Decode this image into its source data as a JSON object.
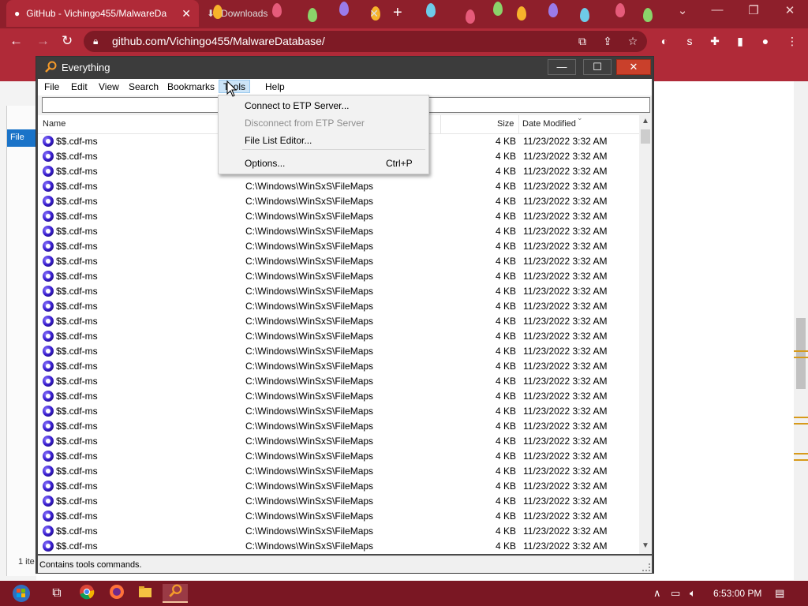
{
  "browser": {
    "tabs": [
      {
        "title": "GitHub - Vichingo455/MalwareDa",
        "active": true
      },
      {
        "title": "Downloads",
        "active": false
      }
    ],
    "new_tab_symbol": "+",
    "url": "github.com/Vichingo455/MalwareDatabase/",
    "icons": [
      "back-icon",
      "forward-icon",
      "reload-icon",
      "lock-icon",
      "install-icon",
      "share-icon",
      "star-icon",
      "extensions-icon",
      "sidebar-icon",
      "profile-icon",
      "menu-icon"
    ],
    "accent": "#b02a38"
  },
  "explorer": {
    "ribbon_label": "File",
    "item_count": "1 ite"
  },
  "everything": {
    "title": "Everything",
    "menus": [
      "File",
      "Edit",
      "View",
      "Search",
      "Bookmarks",
      "Tools",
      "Help"
    ],
    "open_menu": "Tools",
    "search_value": "",
    "columns": {
      "name": "Name",
      "size": "Size",
      "date": "Date Modified"
    },
    "rows": [
      {
        "name": "$$.cdf-ms",
        "path": "",
        "size": "4 KB",
        "date": "11/23/2022 3:32 AM"
      },
      {
        "name": "$$.cdf-ms",
        "path": "",
        "size": "4 KB",
        "date": "11/23/2022 3:32 AM"
      },
      {
        "name": "$$.cdf-ms",
        "path": "",
        "size": "4 KB",
        "date": "11/23/2022 3:32 AM"
      },
      {
        "name": "$$.cdf-ms",
        "path": "C:\\Windows\\WinSxS\\FileMaps",
        "size": "4 KB",
        "date": "11/23/2022 3:32 AM"
      },
      {
        "name": "$$.cdf-ms",
        "path": "C:\\Windows\\WinSxS\\FileMaps",
        "size": "4 KB",
        "date": "11/23/2022 3:32 AM"
      },
      {
        "name": "$$.cdf-ms",
        "path": "C:\\Windows\\WinSxS\\FileMaps",
        "size": "4 KB",
        "date": "11/23/2022 3:32 AM"
      },
      {
        "name": "$$.cdf-ms",
        "path": "C:\\Windows\\WinSxS\\FileMaps",
        "size": "4 KB",
        "date": "11/23/2022 3:32 AM"
      },
      {
        "name": "$$.cdf-ms",
        "path": "C:\\Windows\\WinSxS\\FileMaps",
        "size": "4 KB",
        "date": "11/23/2022 3:32 AM"
      },
      {
        "name": "$$.cdf-ms",
        "path": "C:\\Windows\\WinSxS\\FileMaps",
        "size": "4 KB",
        "date": "11/23/2022 3:32 AM"
      },
      {
        "name": "$$.cdf-ms",
        "path": "C:\\Windows\\WinSxS\\FileMaps",
        "size": "4 KB",
        "date": "11/23/2022 3:32 AM"
      },
      {
        "name": "$$.cdf-ms",
        "path": "C:\\Windows\\WinSxS\\FileMaps",
        "size": "4 KB",
        "date": "11/23/2022 3:32 AM"
      },
      {
        "name": "$$.cdf-ms",
        "path": "C:\\Windows\\WinSxS\\FileMaps",
        "size": "4 KB",
        "date": "11/23/2022 3:32 AM"
      },
      {
        "name": "$$.cdf-ms",
        "path": "C:\\Windows\\WinSxS\\FileMaps",
        "size": "4 KB",
        "date": "11/23/2022 3:32 AM"
      },
      {
        "name": "$$.cdf-ms",
        "path": "C:\\Windows\\WinSxS\\FileMaps",
        "size": "4 KB",
        "date": "11/23/2022 3:32 AM"
      },
      {
        "name": "$$.cdf-ms",
        "path": "C:\\Windows\\WinSxS\\FileMaps",
        "size": "4 KB",
        "date": "11/23/2022 3:32 AM"
      },
      {
        "name": "$$.cdf-ms",
        "path": "C:\\Windows\\WinSxS\\FileMaps",
        "size": "4 KB",
        "date": "11/23/2022 3:32 AM"
      },
      {
        "name": "$$.cdf-ms",
        "path": "C:\\Windows\\WinSxS\\FileMaps",
        "size": "4 KB",
        "date": "11/23/2022 3:32 AM"
      },
      {
        "name": "$$.cdf-ms",
        "path": "C:\\Windows\\WinSxS\\FileMaps",
        "size": "4 KB",
        "date": "11/23/2022 3:32 AM"
      },
      {
        "name": "$$.cdf-ms",
        "path": "C:\\Windows\\WinSxS\\FileMaps",
        "size": "4 KB",
        "date": "11/23/2022 3:32 AM"
      },
      {
        "name": "$$.cdf-ms",
        "path": "C:\\Windows\\WinSxS\\FileMaps",
        "size": "4 KB",
        "date": "11/23/2022 3:32 AM"
      },
      {
        "name": "$$.cdf-ms",
        "path": "C:\\Windows\\WinSxS\\FileMaps",
        "size": "4 KB",
        "date": "11/23/2022 3:32 AM"
      },
      {
        "name": "$$.cdf-ms",
        "path": "C:\\Windows\\WinSxS\\FileMaps",
        "size": "4 KB",
        "date": "11/23/2022 3:32 AM"
      },
      {
        "name": "$$.cdf-ms",
        "path": "C:\\Windows\\WinSxS\\FileMaps",
        "size": "4 KB",
        "date": "11/23/2022 3:32 AM"
      },
      {
        "name": "$$.cdf-ms",
        "path": "C:\\Windows\\WinSxS\\FileMaps",
        "size": "4 KB",
        "date": "11/23/2022 3:32 AM"
      },
      {
        "name": "$$.cdf-ms",
        "path": "C:\\Windows\\WinSxS\\FileMaps",
        "size": "4 KB",
        "date": "11/23/2022 3:32 AM"
      },
      {
        "name": "$$.cdf-ms",
        "path": "C:\\Windows\\WinSxS\\FileMaps",
        "size": "4 KB",
        "date": "11/23/2022 3:32 AM"
      },
      {
        "name": "$$.cdf-ms",
        "path": "C:\\Windows\\WinSxS\\FileMaps",
        "size": "4 KB",
        "date": "11/23/2022 3:32 AM"
      },
      {
        "name": "$$.cdf-ms",
        "path": "C:\\Windows\\WinSxS\\FileMaps",
        "size": "4 KB",
        "date": "11/23/2022 3:32 AM"
      },
      {
        "name": "$$.cdf-ms",
        "path": "C:\\Windows\\WinSxS\\FileMaps",
        "size": "4 KB",
        "date": "11/23/2022 3:32 AM"
      }
    ],
    "tools_menu": [
      {
        "label": "Connect to ETP Server...",
        "shortcut": "",
        "disabled": false
      },
      {
        "label": "Disconnect from ETP Server",
        "shortcut": "",
        "disabled": true
      },
      {
        "label": "File List Editor...",
        "shortcut": "",
        "disabled": false
      },
      {
        "label": "Options...",
        "shortcut": "Ctrl+P",
        "disabled": false
      }
    ],
    "status": "Contains tools commands."
  },
  "taskbar": {
    "apps": [
      "start-icon",
      "task-view-icon",
      "chrome-icon",
      "firefox-icon",
      "file-explorer-icon",
      "everything-icon"
    ],
    "clock": "6:53:00 PM",
    "tray_icons": [
      "chevron-up-icon",
      "network-icon",
      "volume-icon",
      "notification-icon"
    ]
  }
}
